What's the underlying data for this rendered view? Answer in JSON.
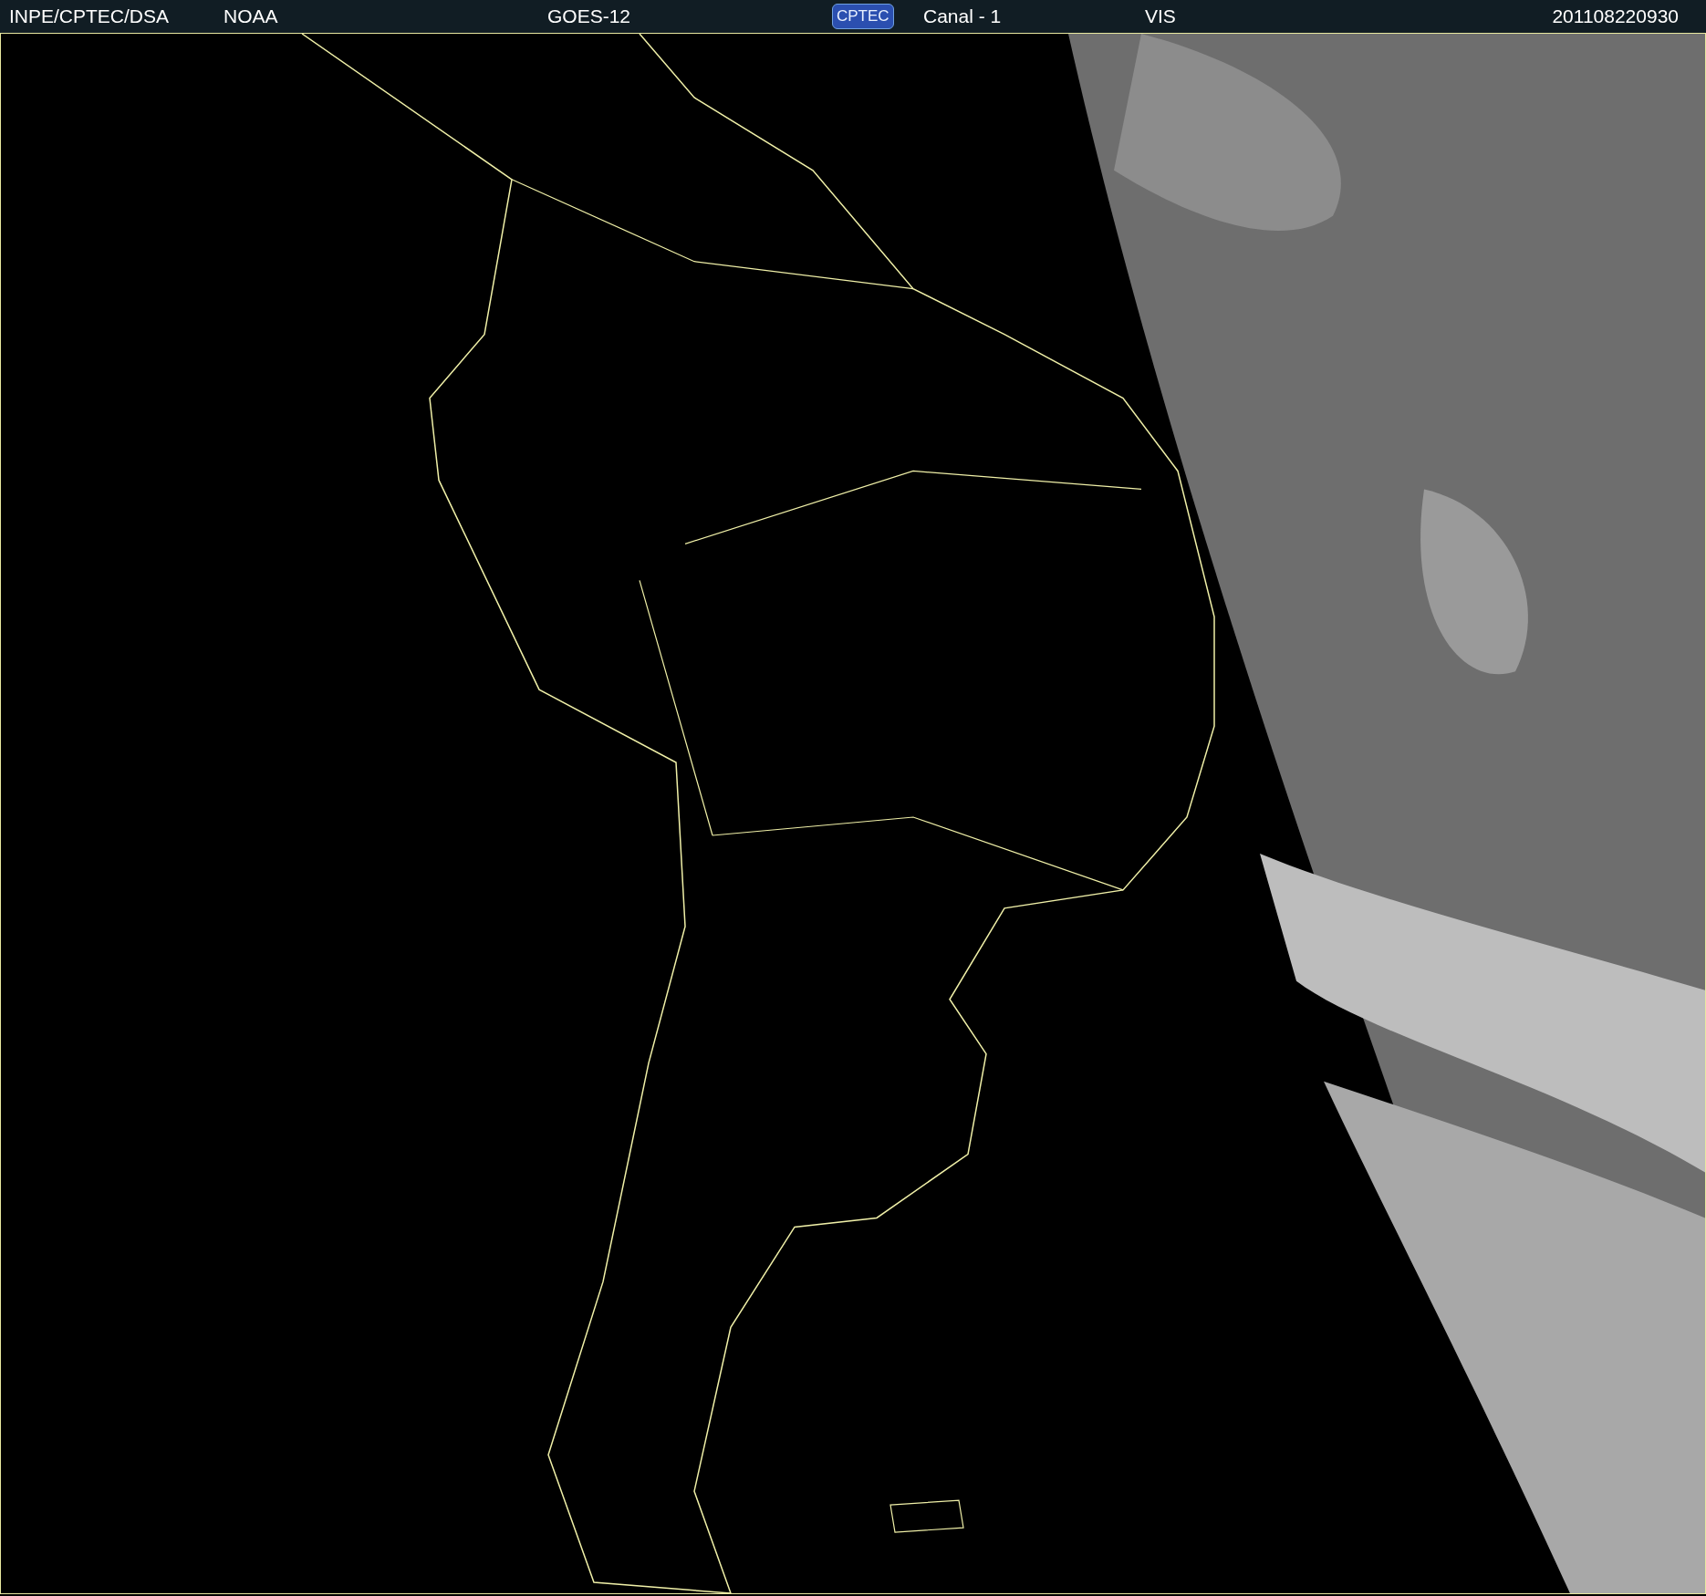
{
  "header": {
    "fields": [
      {
        "kind": "text",
        "text": "INPE/CPTEC/DSA"
      },
      {
        "kind": "text",
        "text": "NOAA"
      },
      {
        "kind": "text",
        "text": "GOES-12"
      },
      {
        "kind": "logo",
        "text": "CPTEC"
      },
      {
        "kind": "text",
        "text": "Canal - 1"
      },
      {
        "kind": "text",
        "text": "VIS"
      },
      {
        "kind": "text",
        "text": "201108220930"
      }
    ]
  }
}
